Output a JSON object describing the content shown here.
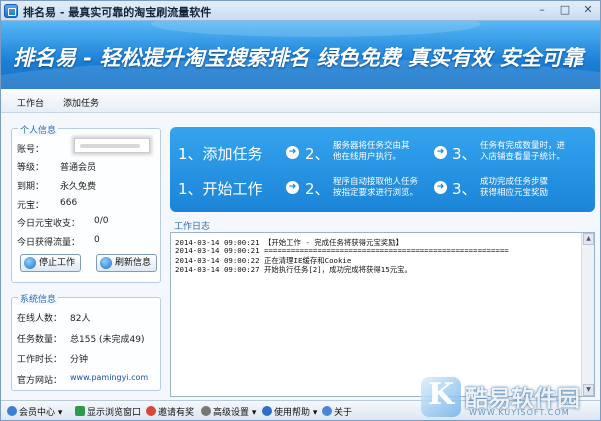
{
  "window": {
    "title": "排名易 - 最真实可靠的淘宝刷流量软件",
    "minimize_glyph": "–",
    "maximize_glyph": "□",
    "close_glyph": "✕"
  },
  "banner": {
    "slogan": "排名易 - 轻松提升淘宝搜索排名   绿色免费  真实有效  安全可靠"
  },
  "menu": {
    "items": [
      {
        "label": "工作台"
      },
      {
        "label": "添加任务"
      }
    ]
  },
  "personal_info": {
    "title": "个人信息",
    "account_label": "账号：",
    "level_label": "等级：",
    "level_value": "普通会员",
    "expire_label": "到期：",
    "expire_value": "永久免费",
    "coins_label": "元宝：",
    "coins_value": "666",
    "today_income_label": "今日元宝收支：",
    "today_income_value": "0/0",
    "today_traffic_label": "今日获得流量：",
    "today_traffic_value": "0",
    "stop_button": "停止工作",
    "refresh_button": "刷新信息"
  },
  "system_info": {
    "title": "系统信息",
    "online_label": "在线人数：",
    "online_value": "82人",
    "tasks_label": "任务数量：",
    "tasks_value": "总155 (未完成49)",
    "worktime_label": "工作时长：",
    "worktime_value": "分钟",
    "site_label": "官方网站：",
    "site_value": "www.pamingyi.com"
  },
  "steps": {
    "row1": [
      {
        "big": "1、添加任务"
      },
      {
        "num": "2、",
        "text": "服务器将任务交由其\n他在线用户执行。"
      },
      {
        "num": "3、",
        "text": "任务有完成数量时，进\n入店铺查看量子统计。"
      }
    ],
    "row2": [
      {
        "big": "1、开始工作"
      },
      {
        "num": "2、",
        "text": "程序自动接取他人任务\n按指定要求进行浏览。"
      },
      {
        "num": "3、",
        "text": "成功完成任务步骤\n获得相应元宝奖励"
      }
    ],
    "arrow_glyph": "➜"
  },
  "log": {
    "title": "工作日志",
    "lines": [
      "2014-03-14 09:00:21  【开始工作 - 完成任务将获得元宝奖励】",
      "2014-03-14 09:00:21  =======================================================",
      "2014-03-14 09:00:22  正在清理IE缓存和Cookie",
      "2014-03-14 09:00:27  开始执行任务[2]，成功完成将获得15元宝。"
    ],
    "scroll_up": "▲",
    "scroll_down": "▼"
  },
  "statusbar": {
    "items": [
      {
        "label": "会员中心 ▾",
        "icon": "member-icon",
        "color": "#3b7fd0"
      },
      {
        "label": "显示浏览窗口",
        "icon": "browser-window-icon",
        "color": "#2f9a4a"
      },
      {
        "label": "邀请有奖",
        "icon": "gift-icon",
        "color": "#d9463a"
      },
      {
        "label": "高级设置 ▾",
        "icon": "settings-icon",
        "color": "#777777"
      },
      {
        "label": "使用帮助 ▾",
        "icon": "help-icon",
        "color": "#2d6fc4"
      },
      {
        "label": "关于",
        "icon": "info-icon",
        "color": "#4a86d6"
      }
    ]
  },
  "watermark": {
    "logo_letter": "K",
    "text": "酷易软件园",
    "url": "WWW.KUYISOFT.COM"
  },
  "colors": {
    "banner": "#1b7fd6",
    "steps_panel": "#2596e6",
    "group_title": "#2c6cb5"
  }
}
